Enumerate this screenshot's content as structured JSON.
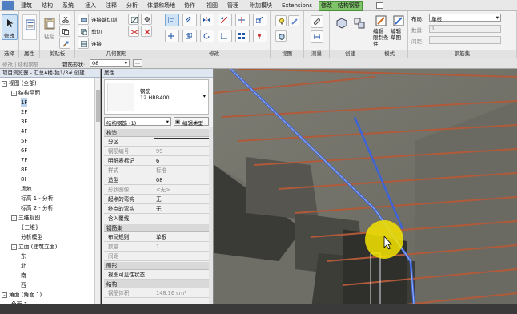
{
  "menu_tabs": [
    "建筑",
    "结构",
    "系统",
    "插入",
    "注释",
    "分析",
    "体量和场地",
    "协作",
    "视图",
    "管理",
    "附加模块",
    "Extensions",
    "修改 | 结构钢筋"
  ],
  "active_tab": "修改 | 结构钢筋",
  "ribbon": {
    "modify_label": "修改",
    "paste_label": "粘贴",
    "cut_label": "连接端切割",
    "cope_label": "剪切",
    "join_label": "连接",
    "panels": [
      "选择",
      "属性",
      "剪贴板",
      "几何图形",
      "修改",
      "视图",
      "测量",
      "创建",
      "模式",
      "钢筋集"
    ],
    "edit_constraint_label": "编辑\n限制条件",
    "edit_sketch_label": "编辑\n草图",
    "layout_label": "布局:",
    "layout_value": "单根",
    "quantity_label": "数量:",
    "quantity_value": "1",
    "spacing_label": "间距:"
  },
  "options_bar": {
    "label": "修改 | 结构钢筋",
    "rebar_shape_label": "钢筋形状:",
    "rebar_shape_value": "08"
  },
  "project_browser": {
    "title": "项目浏览器 - 汇总A楼-独1/3#.创建...",
    "items": [
      {
        "label": "视图 (全部)",
        "level": 0,
        "twist": "-"
      },
      {
        "label": "结构平面",
        "level": 1,
        "twist": "-"
      },
      {
        "label": "1F",
        "level": 2,
        "highlight": true
      },
      {
        "label": "2F",
        "level": 2
      },
      {
        "label": "3F",
        "level": 2
      },
      {
        "label": "4F",
        "level": 2
      },
      {
        "label": "5F",
        "level": 2
      },
      {
        "label": "6F",
        "level": 2
      },
      {
        "label": "7F",
        "level": 2
      },
      {
        "label": "8F",
        "level": 2
      },
      {
        "label": "8I",
        "level": 2
      },
      {
        "label": "场地",
        "level": 2
      },
      {
        "label": "标高 1 - 分析",
        "level": 2
      },
      {
        "label": "标高 2 - 分析",
        "level": 2
      },
      {
        "label": "三维视图",
        "level": 1,
        "twist": "-"
      },
      {
        "label": "{三维}",
        "level": 2
      },
      {
        "label": "分析模型",
        "level": 2
      },
      {
        "label": "立面 (建筑立面)",
        "level": 1,
        "twist": "-"
      },
      {
        "label": "东",
        "level": 2
      },
      {
        "label": "北",
        "level": 2
      },
      {
        "label": "南",
        "level": 2
      },
      {
        "label": "西",
        "level": 2
      },
      {
        "label": "角面 (角面 1)",
        "level": 0,
        "twist": "-"
      },
      {
        "label": "角面 1",
        "level": 1
      }
    ]
  },
  "properties": {
    "title": "属性",
    "type_family": "钢筋",
    "type_name": "12 HRB400",
    "selector": "结构钢筋 (1)",
    "edit_type": "编辑类型",
    "sections": [
      {
        "title": "构造",
        "rows": [
          {
            "k": "分区",
            "v": "",
            "box": true
          },
          {
            "k": "钢筋编号",
            "v": "99",
            "grey": true
          },
          {
            "k": "明细表标记",
            "v": "6"
          },
          {
            "k": "样式",
            "v": "标准",
            "grey": true
          },
          {
            "k": "造型",
            "v": "08"
          },
          {
            "k": "形状图像",
            "v": "<无>",
            "grey": true
          },
          {
            "k": "起点的弯钩",
            "v": "无"
          },
          {
            "k": "终点的弯钩",
            "v": "无"
          },
          {
            "k": "含入覆线",
            "v": "",
            "button": "编辑..."
          }
        ]
      },
      {
        "title": "钢筋集",
        "rows": [
          {
            "k": "布局规则",
            "v": "单根"
          },
          {
            "k": "数量",
            "v": "1",
            "grey": true
          },
          {
            "k": "间距",
            "v": "",
            "grey": true
          }
        ]
      },
      {
        "title": "图形",
        "rows": [
          {
            "k": "视图可见性状态",
            "v": "",
            "button": "编辑..."
          }
        ]
      },
      {
        "title": "结构",
        "rows": [
          {
            "k": "钢筋体积",
            "v": "148.16 cm³",
            "grey": true
          }
        ]
      }
    ]
  },
  "colors": {
    "context_tab": "#7fc46b",
    "highlight_cursor": "#f5e400",
    "rebar_selected": "#3d63d8",
    "rebar": "#b05a3a",
    "concrete": "#6e6e66"
  }
}
